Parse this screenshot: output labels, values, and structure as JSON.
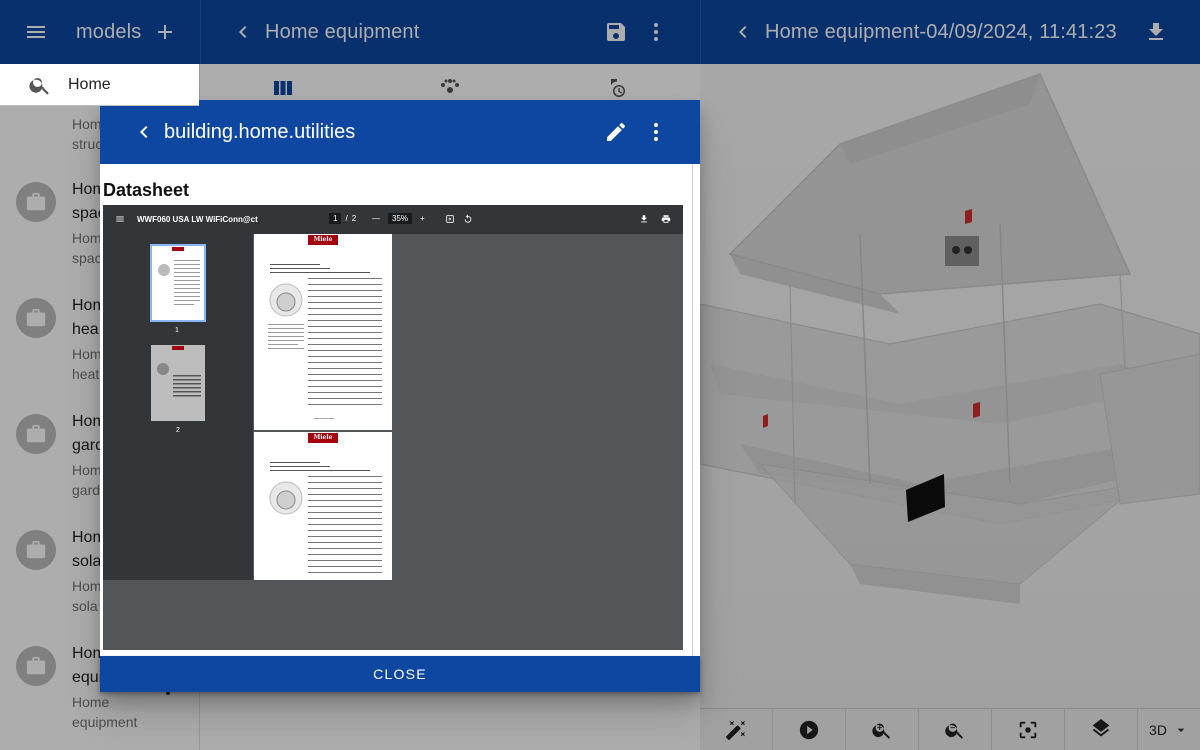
{
  "left_bar": {
    "title": "models"
  },
  "mid_bar": {
    "title": "Home equipment"
  },
  "right_bar": {
    "title": "Home equipment-04/09/2024, 11:41:23"
  },
  "search": {
    "value": "Home"
  },
  "list": [
    {
      "title": "stru",
      "subtitle": "Hom\nstruc"
    },
    {
      "title": "Hom\nspac",
      "subtitle": "Hom\nspac"
    },
    {
      "title": "Hom\nhea",
      "subtitle": "Hom\nheat"
    },
    {
      "title": "Hom\ngard",
      "subtitle": "Hom\ngard"
    },
    {
      "title": "Hom\nsola",
      "subtitle": "Hom\nsola"
    },
    {
      "title": "Home\nequipment",
      "subtitle": "Home\nequipment"
    }
  ],
  "dialog": {
    "title": "building.home.utilities",
    "section_label": "Datasheet",
    "close_label": "CLOSE"
  },
  "pdf": {
    "doc_title": "WWF060 USA LW WiFiConn@ct",
    "current_page": "1",
    "page_sep": "/",
    "total_pages": "2",
    "zoom": "35%",
    "thumb_labels": [
      "1",
      "2"
    ],
    "brand": "Miele"
  },
  "viewer_toolbar": {
    "view_mode": "3D"
  },
  "colors": {
    "primary": "#0d47a1",
    "scrim": "rgba(0,0,0,0.32)",
    "brand_red": "#a5000d"
  }
}
